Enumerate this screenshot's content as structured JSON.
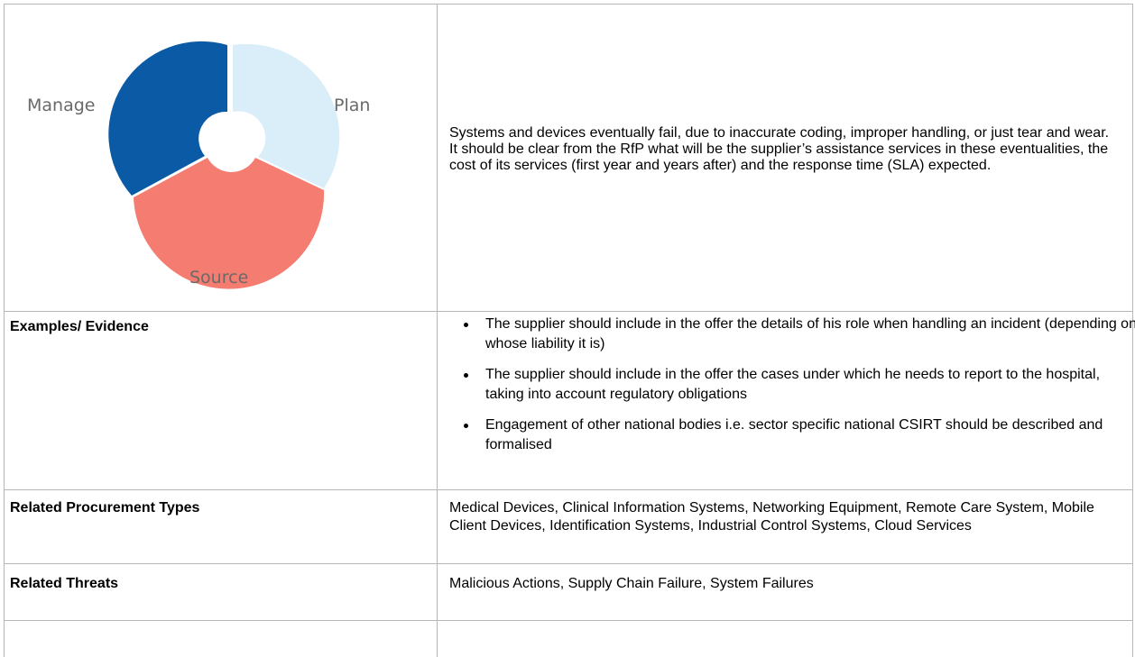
{
  "diagram": {
    "segments": [
      {
        "label": "Plan",
        "color": "#daeefa"
      },
      {
        "label": "Source",
        "color": "#f47c70"
      },
      {
        "label": "Manage",
        "color": "#0b5aa6"
      }
    ]
  },
  "description": "Systems and devices eventually fail, due to inaccurate coding, improper handling, or just tear and wear. It should be clear from the RfP what will be the supplier’s assistance services in these eventualities, the cost of its services (first year and years after) and the response time (SLA) expected.",
  "rows": {
    "examples": {
      "label": "Examples/ Evidence",
      "items": [
        "The supplier should include in the offer the details of his role when handling an incident (depending on whose liability it is)",
        "The supplier should include in the offer the cases under which he needs to report to the hospital, taking into account regulatory obligations",
        "Engagement of other national bodies  i.e. sector specific national CSIRT should be described and formalised"
      ]
    },
    "procurement": {
      "label": "Related Procurement Types",
      "value": "Medical Devices, Clinical Information Systems, Networking Equipment, Remote Care System, Mobile Client Devices, Identification Systems, Industrial Control Systems, Cloud Services"
    },
    "threats": {
      "label": "Related Threats",
      "value": "Malicious Actions, Supply Chain Failure, System Failures"
    }
  }
}
